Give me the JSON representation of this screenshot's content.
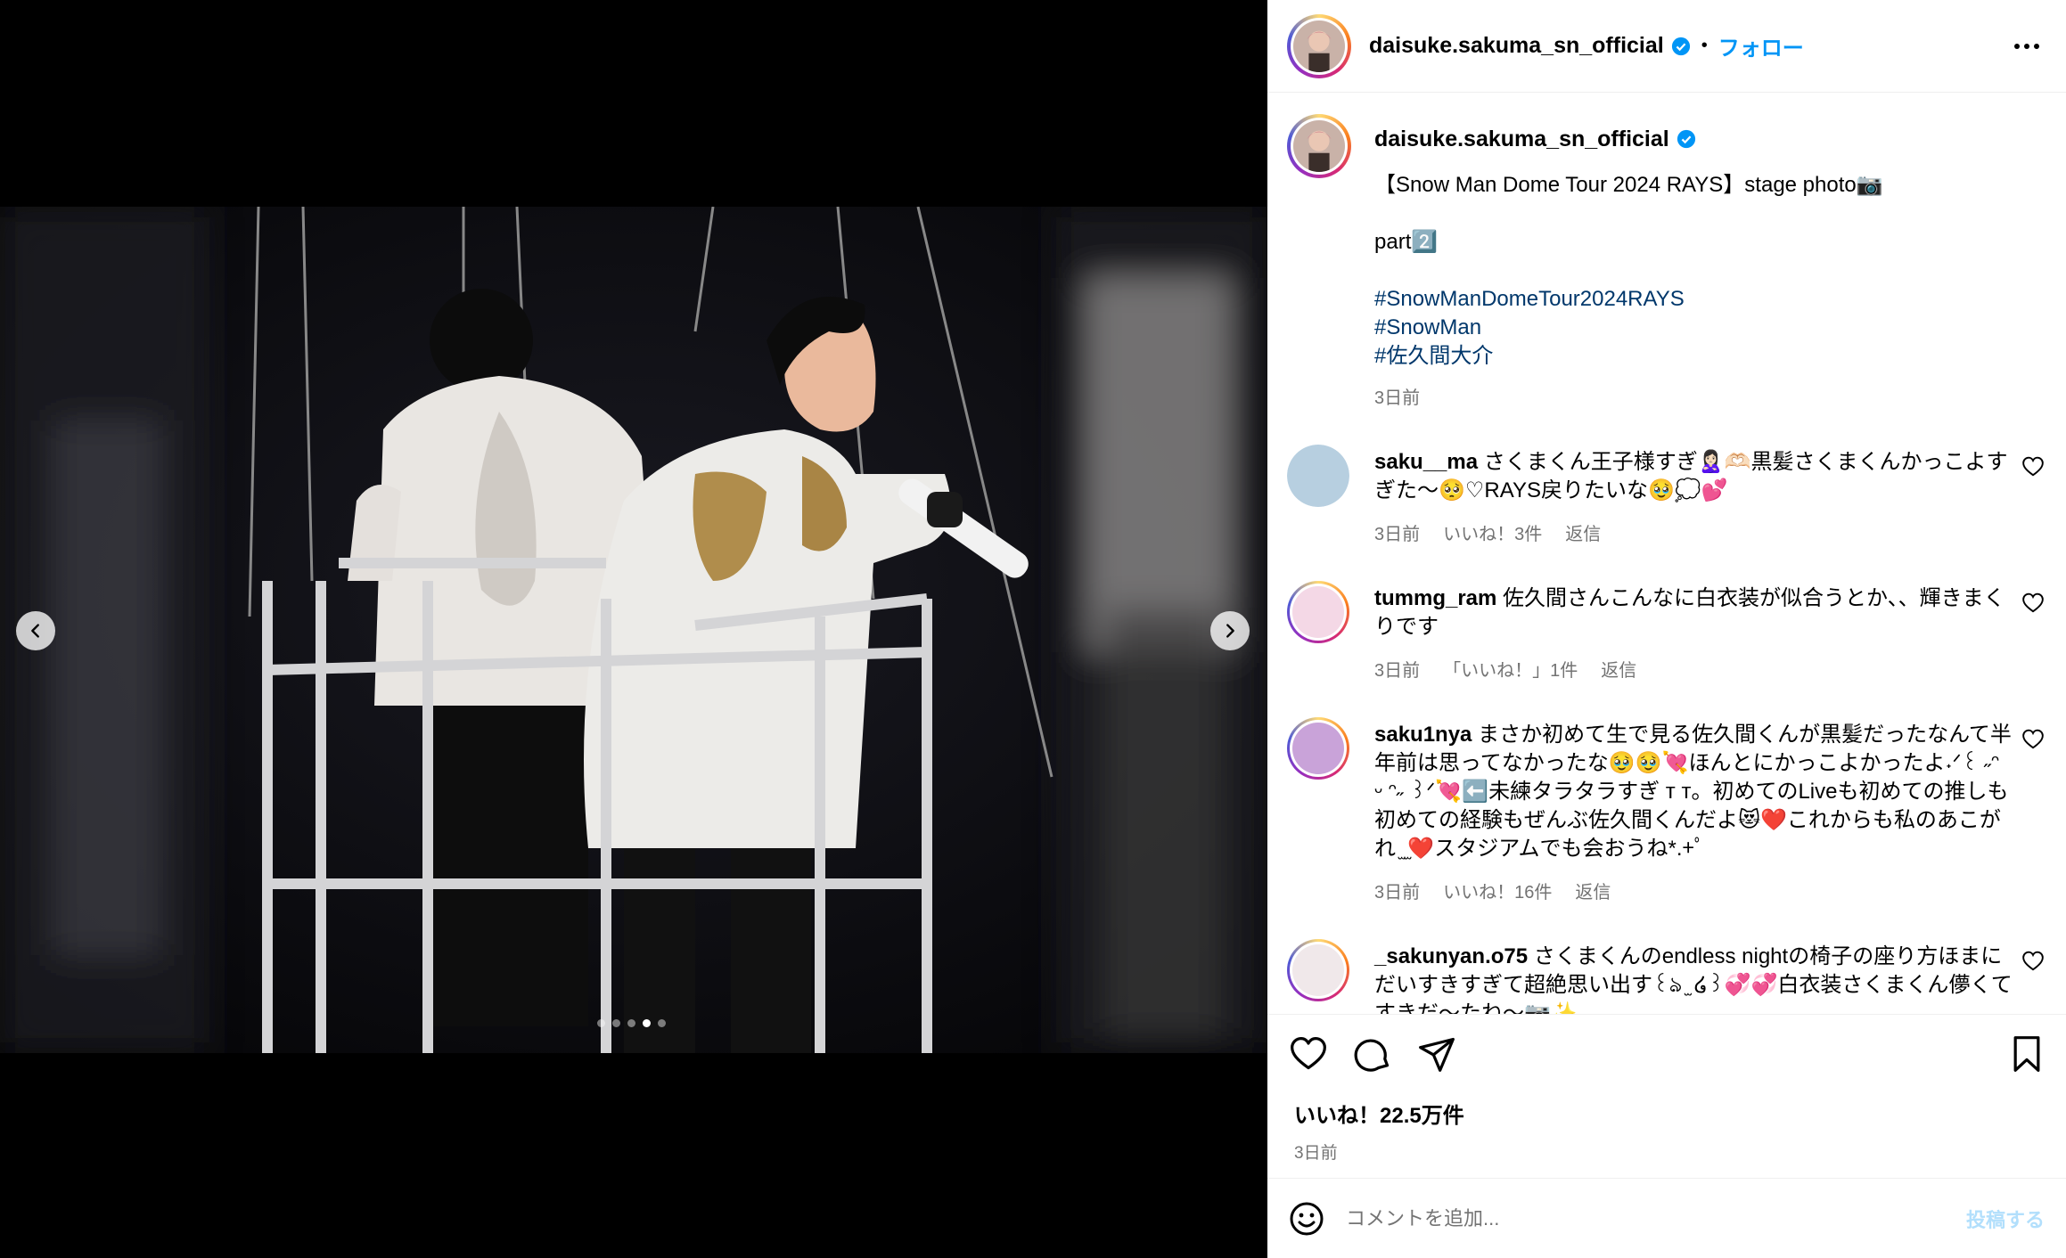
{
  "post": {
    "username": "daisuke.sakuma_sn_official",
    "bullet": "•",
    "follow_label": "フォロー",
    "caption_lines": [
      "【Snow Man Dome Tour 2024 RAYS】stage photo📷",
      "part2️⃣"
    ],
    "hashtags": [
      "#SnowManDomeTour2024RAYS",
      "#SnowMan",
      "#佐久間大介"
    ],
    "caption_time": "3日前",
    "likes": "いいね！22.5万件",
    "date": "3日前"
  },
  "carousel": {
    "total": 5,
    "active_index": 3
  },
  "comments": [
    {
      "user": "saku__ma",
      "text": "さくまくん王子様すぎ🙎🏻‍♀️🫶🏻黒髪さくまくんかっこよすぎた〜🥺♡RAYS戻りたいな🥹💭💕",
      "time": "3日前",
      "likes": "いいね！3件",
      "reply": "返信"
    },
    {
      "user": "tummg_ram",
      "text": "佐久間さんこんなに白衣装が似合うとか、、輝きまくりです",
      "time": "3日前",
      "likes": "「いいね！」1件",
      "reply": "返信"
    },
    {
      "user": "saku1nya",
      "text": "まさか初めて生で見る佐久間くんが黒髪だったなんて半年前は思ってなかったな🥹🥹💘ほんとにかっこよかったよ˖ᐟ꒰ ˶ᵔ ᵕ ᵔ˶ ꒱ᐟ💘⬅️未練タラタラすぎ т т。初めてのLiveも初めての推しも初めての経験もぜんぶ佐久間くんだよ😻❤️これからも私のあこがれ ̫ ̫❤️スタジアムでも会おうね*.+ﾟ",
      "time": "3日前",
      "likes": "いいね！16件",
      "reply": "返信"
    },
    {
      "user": "_sakunyan.o75",
      "text": "さくまくんのendless nightの椅子の座り方ほまにだいすきすぎて超絶思い出す꒰ঌ ̫ ໒꒱💞💞白衣装さくまくん儚くてすきだ〜たね〜📷✨",
      "time": "",
      "likes": "",
      "reply": ""
    }
  ],
  "comment_bar": {
    "placeholder": "コメントを追加...",
    "post_label": "投稿する"
  },
  "icons": {
    "verified": "verified-badge-icon",
    "more": "more-options-icon",
    "like": "heart-icon",
    "comment": "comment-icon",
    "share": "share-icon",
    "save": "bookmark-icon",
    "emoji": "emoji-icon",
    "prev": "chevron-left-icon",
    "next": "chevron-right-icon"
  },
  "colors": {
    "accent": "#0095f6",
    "hashtag": "#00376b",
    "muted": "#737373"
  }
}
